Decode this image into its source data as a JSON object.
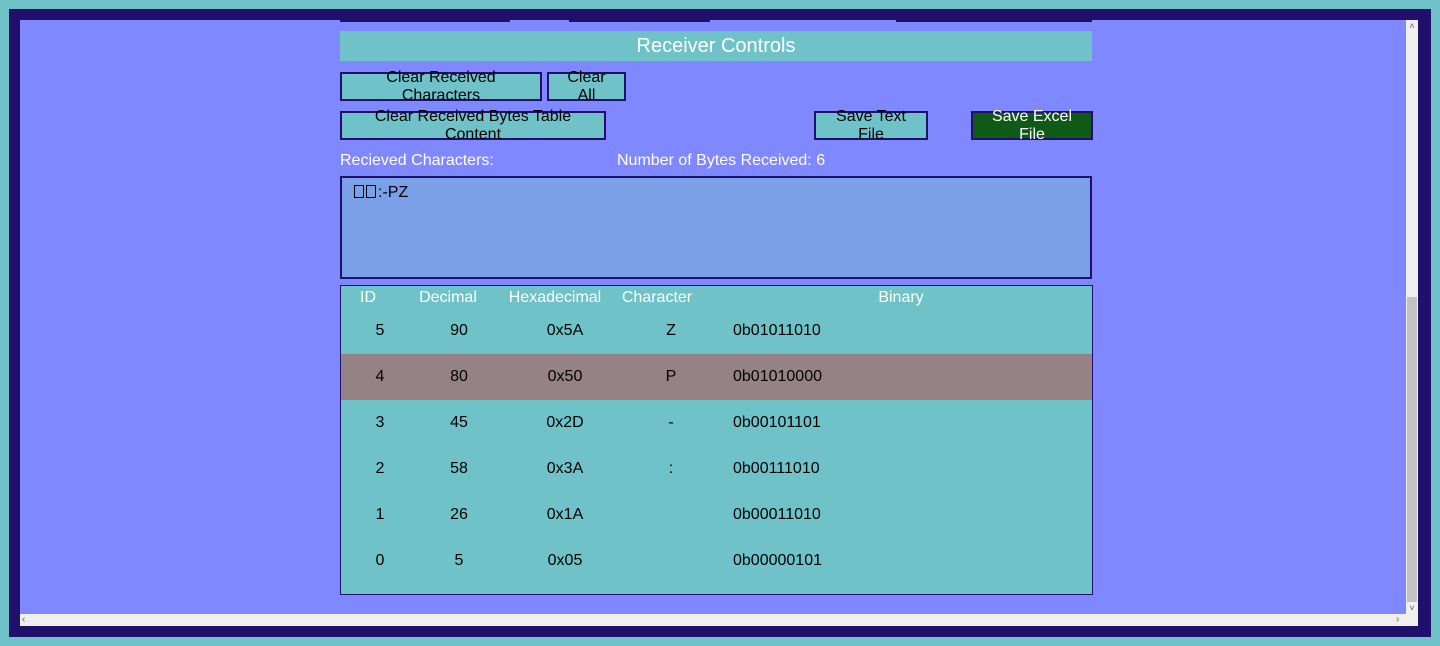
{
  "header": {
    "title": "Receiver Controls"
  },
  "buttons": {
    "clear_received_characters": "Clear Received Characters",
    "clear_all": "Clear All",
    "clear_bytes_table": "Clear Received Bytes Table Content",
    "save_text_file": "Save Text File",
    "save_excel_file": "Save Excel File"
  },
  "labels": {
    "received_characters": "Recieved Characters:",
    "bytes_received": "Number of Bytes Received: 6"
  },
  "received_text": ":-PZ",
  "table": {
    "columns": [
      "ID",
      "Decimal",
      "Hexadecimal",
      "Character",
      "Binary"
    ],
    "rows": [
      [
        "5",
        "90",
        "0x5A",
        "Z",
        "0b01011010"
      ],
      [
        "4",
        "80",
        "0x50",
        "P",
        "0b01010000"
      ],
      [
        "3",
        "45",
        "0x2D",
        "-",
        "0b00101101"
      ],
      [
        "2",
        "58",
        "0x3A",
        ":",
        "0b00111010"
      ],
      [
        "1",
        "26",
        "0x1A",
        "",
        "0b00011010"
      ],
      [
        "0",
        "5",
        "0x05",
        "",
        "0b00000101"
      ]
    ],
    "selected_row_id": "4"
  },
  "colors": {
    "background": "#7f88ff",
    "frame": "#21106b",
    "accent": "#6fc3c8",
    "selected_row": "#958285",
    "excel_button": "#0f5a17",
    "text_box": "#7aa0e8"
  },
  "icons": {
    "scroll_up": "chevron-up-icon",
    "scroll_down": "chevron-down-icon",
    "scroll_left": "chevron-left-icon",
    "scroll_right": "chevron-right-icon",
    "unknown_char": "missing-glyph-icon"
  }
}
